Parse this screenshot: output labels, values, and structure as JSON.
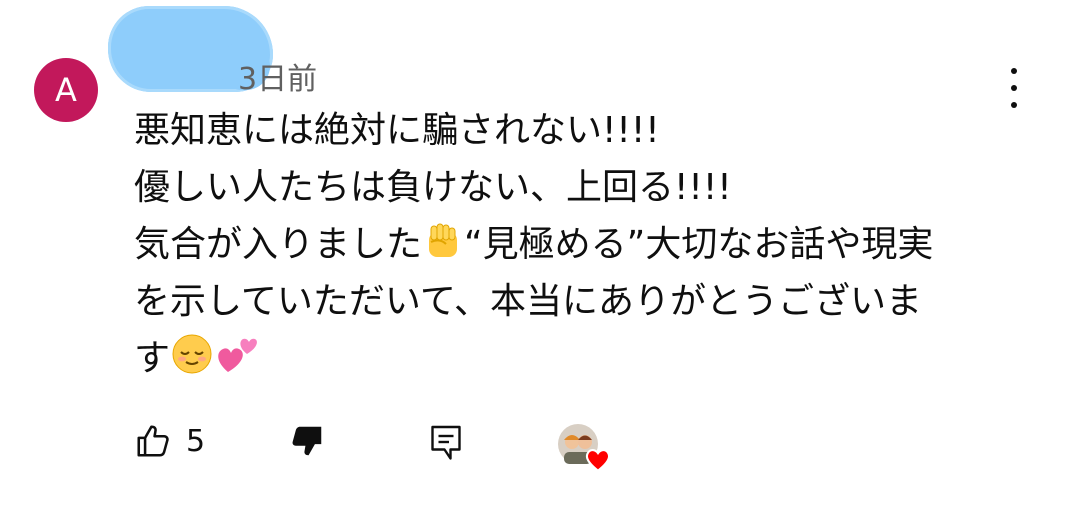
{
  "comment": {
    "author_initial": "A",
    "time_label": "3日前",
    "lines": [
      "悪知恵には絶対に騙されない!!!!",
      "優しい人たちは負けない、上回る!!!!",
      "気合が入りました",
      "“見極める”大切なお話や現実",
      "を示していただいて、本当にありがとうございま",
      "す"
    ],
    "emoji": [
      "raised-fist",
      "relieved-face",
      "two-hearts"
    ]
  },
  "actions": {
    "like_count": "5",
    "icons": [
      "thumb-up-icon",
      "thumb-down-icon",
      "reply-icon",
      "creator-heart-icon"
    ]
  },
  "colors": {
    "avatar_bg": "#c2185b",
    "redaction": "#8ecdfb",
    "meta_text": "#606060",
    "heart": "#ff0000"
  }
}
